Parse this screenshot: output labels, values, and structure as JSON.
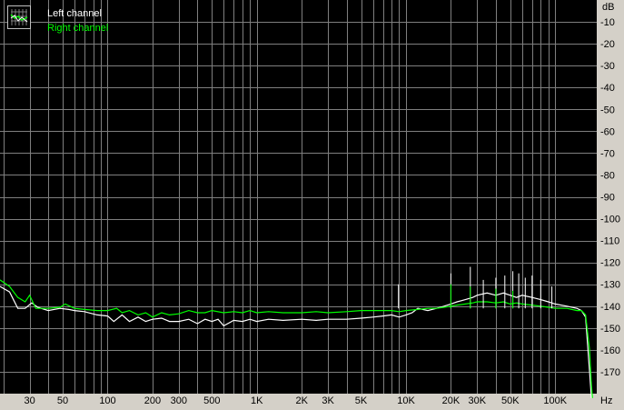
{
  "legend": {
    "left_label": "Left channel",
    "right_label": "Right channel"
  },
  "colors": {
    "background": "#000000",
    "grid": "#7f7f7f",
    "axis_panel": "#d4d0c8",
    "left_channel": "#ffffff",
    "right_channel": "#00ff00"
  },
  "chart_data": {
    "type": "line",
    "title": "",
    "xlabel": "Hz",
    "ylabel": "dB",
    "x_scale": "log",
    "xlim": [
      19,
      190000
    ],
    "ylim": [
      -180,
      0
    ],
    "grid": true,
    "legend_position": "top-left",
    "x_ticks": [
      {
        "v": 30,
        "label": "30"
      },
      {
        "v": 50,
        "label": "50"
      },
      {
        "v": 100,
        "label": "100"
      },
      {
        "v": 200,
        "label": "200"
      },
      {
        "v": 300,
        "label": "300"
      },
      {
        "v": 500,
        "label": "500"
      },
      {
        "v": 1000,
        "label": "1K"
      },
      {
        "v": 2000,
        "label": "2K"
      },
      {
        "v": 3000,
        "label": "3K"
      },
      {
        "v": 5000,
        "label": "5K"
      },
      {
        "v": 10000,
        "label": "10K"
      },
      {
        "v": 20000,
        "label": "20K"
      },
      {
        "v": 30000,
        "label": "30K"
      },
      {
        "v": 50000,
        "label": "50K"
      },
      {
        "v": 100000,
        "label": "100K"
      }
    ],
    "y_ticks": [
      {
        "v": -10,
        "label": "-10"
      },
      {
        "v": -20,
        "label": "-20"
      },
      {
        "v": -30,
        "label": "-30"
      },
      {
        "v": -40,
        "label": "-40"
      },
      {
        "v": -50,
        "label": "-50"
      },
      {
        "v": -60,
        "label": "-60"
      },
      {
        "v": -70,
        "label": "-70"
      },
      {
        "v": -80,
        "label": "-80"
      },
      {
        "v": -90,
        "label": "-90"
      },
      {
        "v": -100,
        "label": "-100"
      },
      {
        "v": -110,
        "label": "-110"
      },
      {
        "v": -120,
        "label": "-120"
      },
      {
        "v": -130,
        "label": "-130"
      },
      {
        "v": -140,
        "label": "-140"
      },
      {
        "v": -150,
        "label": "-150"
      },
      {
        "v": -160,
        "label": "-160"
      },
      {
        "v": -170,
        "label": "-170"
      }
    ],
    "series": [
      {
        "name": "Left channel",
        "color": "#ffffff",
        "points": [
          [
            19,
            -131
          ],
          [
            22,
            -133.5
          ],
          [
            25,
            -141
          ],
          [
            28,
            -141
          ],
          [
            31,
            -138.5
          ],
          [
            34,
            -140.5
          ],
          [
            40,
            -142
          ],
          [
            48,
            -141
          ],
          [
            55,
            -141.5
          ],
          [
            60,
            -142
          ],
          [
            70,
            -142.5
          ],
          [
            85,
            -144
          ],
          [
            100,
            -144.5
          ],
          [
            110,
            -147
          ],
          [
            125,
            -144
          ],
          [
            140,
            -147
          ],
          [
            160,
            -145
          ],
          [
            180,
            -147
          ],
          [
            200,
            -146
          ],
          [
            230,
            -145.5
          ],
          [
            260,
            -147
          ],
          [
            300,
            -147
          ],
          [
            350,
            -146
          ],
          [
            400,
            -148
          ],
          [
            450,
            -146
          ],
          [
            500,
            -147
          ],
          [
            550,
            -146
          ],
          [
            600,
            -149
          ],
          [
            700,
            -146.5
          ],
          [
            800,
            -147
          ],
          [
            900,
            -146
          ],
          [
            1000,
            -147
          ],
          [
            1200,
            -146
          ],
          [
            1500,
            -146.5
          ],
          [
            2000,
            -146
          ],
          [
            2500,
            -146.5
          ],
          [
            3000,
            -146
          ],
          [
            4000,
            -146
          ],
          [
            5000,
            -145.5
          ],
          [
            6000,
            -145
          ],
          [
            7000,
            -144.5
          ],
          [
            8000,
            -144
          ],
          [
            9000,
            -145
          ],
          [
            10000,
            -144
          ],
          [
            11000,
            -143
          ],
          [
            12000,
            -141
          ],
          [
            14000,
            -142
          ],
          [
            16000,
            -141
          ],
          [
            18000,
            -140
          ],
          [
            20000,
            -139
          ],
          [
            22000,
            -138
          ],
          [
            25000,
            -137
          ],
          [
            28000,
            -136
          ],
          [
            30000,
            -135
          ],
          [
            35000,
            -134
          ],
          [
            40000,
            -135
          ],
          [
            45000,
            -134
          ],
          [
            50000,
            -135
          ],
          [
            55000,
            -136
          ],
          [
            60000,
            -135
          ],
          [
            70000,
            -136
          ],
          [
            80000,
            -137
          ],
          [
            90000,
            -138
          ],
          [
            100000,
            -139
          ],
          [
            120000,
            -140
          ],
          [
            140000,
            -141
          ],
          [
            150000,
            -142
          ],
          [
            160000,
            -145
          ],
          [
            170000,
            -170
          ],
          [
            175000,
            -182
          ]
        ]
      },
      {
        "name": "Right channel",
        "color": "#00ff00",
        "points": [
          [
            19,
            -128
          ],
          [
            22,
            -131
          ],
          [
            25,
            -136
          ],
          [
            28,
            -138
          ],
          [
            30,
            -135
          ],
          [
            33,
            -141
          ],
          [
            40,
            -141
          ],
          [
            48,
            -140.5
          ],
          [
            52,
            -139
          ],
          [
            60,
            -141
          ],
          [
            70,
            -141.5
          ],
          [
            85,
            -142
          ],
          [
            100,
            -142
          ],
          [
            115,
            -141
          ],
          [
            125,
            -143
          ],
          [
            140,
            -142
          ],
          [
            160,
            -144
          ],
          [
            180,
            -143
          ],
          [
            200,
            -145
          ],
          [
            230,
            -143
          ],
          [
            260,
            -144
          ],
          [
            300,
            -143.5
          ],
          [
            350,
            -142
          ],
          [
            400,
            -143
          ],
          [
            450,
            -143
          ],
          [
            500,
            -142
          ],
          [
            600,
            -143
          ],
          [
            700,
            -142.5
          ],
          [
            800,
            -143
          ],
          [
            900,
            -142
          ],
          [
            1000,
            -143
          ],
          [
            1200,
            -142.5
          ],
          [
            1500,
            -143
          ],
          [
            2000,
            -143
          ],
          [
            2500,
            -142.5
          ],
          [
            3000,
            -143
          ],
          [
            4000,
            -142.5
          ],
          [
            5000,
            -142
          ],
          [
            6000,
            -142
          ],
          [
            7000,
            -142
          ],
          [
            8000,
            -142
          ],
          [
            9000,
            -142.5
          ],
          [
            10000,
            -142
          ],
          [
            12000,
            -141.5
          ],
          [
            14000,
            -141
          ],
          [
            16000,
            -141
          ],
          [
            18000,
            -140.5
          ],
          [
            20000,
            -140
          ],
          [
            22000,
            -139.5
          ],
          [
            25000,
            -139
          ],
          [
            28000,
            -138.5
          ],
          [
            30000,
            -138
          ],
          [
            35000,
            -138
          ],
          [
            40000,
            -138.5
          ],
          [
            45000,
            -138
          ],
          [
            50000,
            -139
          ],
          [
            55000,
            -138.5
          ],
          [
            60000,
            -139
          ],
          [
            70000,
            -139.5
          ],
          [
            80000,
            -140
          ],
          [
            90000,
            -140.5
          ],
          [
            100000,
            -141
          ],
          [
            120000,
            -141
          ],
          [
            140000,
            -142
          ],
          [
            150000,
            -142
          ],
          [
            160000,
            -144
          ],
          [
            170000,
            -160
          ],
          [
            175000,
            -176
          ],
          [
            178000,
            -182
          ]
        ]
      }
    ],
    "peaks": [
      {
        "series": 0,
        "x": 8900,
        "y": -130
      },
      {
        "series": 0,
        "x": 20000,
        "y": -125
      },
      {
        "series": 0,
        "x": 27000,
        "y": -122
      },
      {
        "series": 0,
        "x": 33000,
        "y": -128
      },
      {
        "series": 0,
        "x": 40000,
        "y": -127
      },
      {
        "series": 0,
        "x": 46000,
        "y": -126
      },
      {
        "series": 0,
        "x": 52000,
        "y": -124
      },
      {
        "series": 0,
        "x": 57000,
        "y": -125
      },
      {
        "series": 0,
        "x": 63000,
        "y": -127
      },
      {
        "series": 0,
        "x": 70000,
        "y": -126
      },
      {
        "series": 0,
        "x": 80000,
        "y": -128
      },
      {
        "series": 0,
        "x": 95000,
        "y": -131
      },
      {
        "series": 1,
        "x": 20000,
        "y": -130
      },
      {
        "series": 1,
        "x": 27000,
        "y": -131
      },
      {
        "series": 1,
        "x": 40000,
        "y": -132
      },
      {
        "series": 1,
        "x": 52000,
        "y": -133
      }
    ]
  }
}
